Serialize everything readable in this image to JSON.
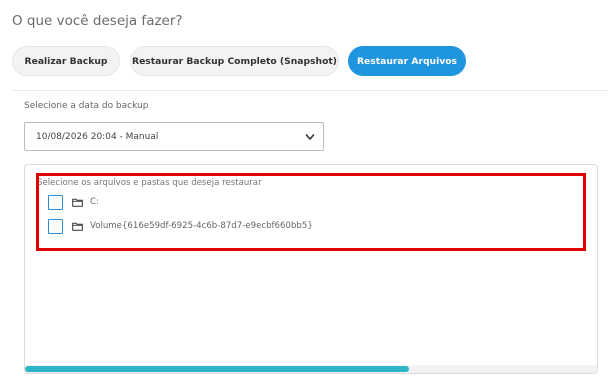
{
  "header": {
    "title": "O que você deseja fazer?"
  },
  "actions": {
    "backup_label": "Realizar Backup",
    "restore_snapshot_label": "Restaurar Backup Completo (Snapshot)",
    "restore_files_label": "Restaurar Arquivos",
    "active": "restore_files"
  },
  "date_picker": {
    "label": "Selecione a data do backup",
    "selected_value": "10/08/2026 20:04 - Manual"
  },
  "file_tree": {
    "title": "Selecione os arquivos e pastas que deseja restaurar",
    "items": [
      {
        "label": "C:",
        "checked": false,
        "icon": "folder-icon"
      },
      {
        "label": "Volume{616e59df-6925-4c6b-87d7-e9ecbf660bb5}",
        "checked": false,
        "icon": "folder-icon"
      }
    ],
    "horizontal_scroll_position": 0
  },
  "colors": {
    "accent": "#1f94df",
    "checkbox_border": "#2b8fd6",
    "scrollbar_thumb": "#2bb5c6",
    "highlight": "#e00000"
  }
}
